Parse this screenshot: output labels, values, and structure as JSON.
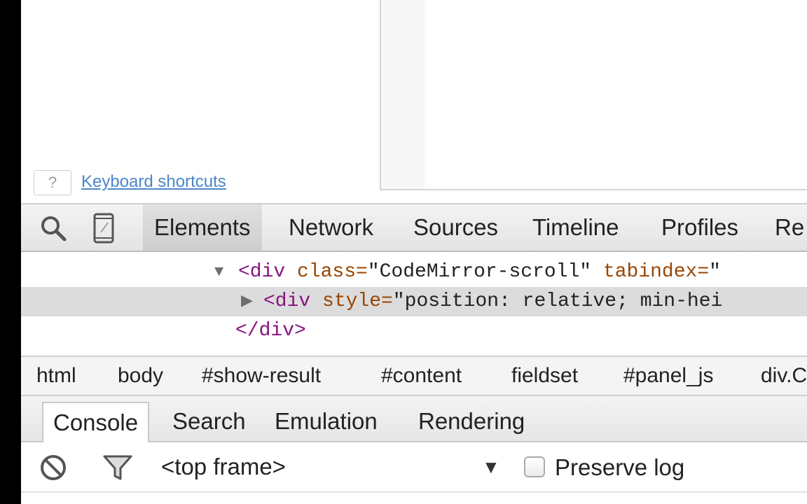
{
  "page": {
    "help_key": "?",
    "keyboard_link": "Keyboard shortcuts"
  },
  "devtools": {
    "tabs": [
      {
        "label": "Elements",
        "active": true
      },
      {
        "label": "Network"
      },
      {
        "label": "Sources"
      },
      {
        "label": "Timeline"
      },
      {
        "label": "Profiles"
      },
      {
        "label": "Re"
      }
    ],
    "icons": {
      "search": "search-icon",
      "device": "device-mode-icon"
    },
    "tree": {
      "row1": {
        "open": "<div",
        "attr1": " class=",
        "val1": "\"CodeMirror-scroll\"",
        "attr2": " tabindex=",
        "val2": "\""
      },
      "row2": {
        "open": "<div",
        "attr1": " style=",
        "val1": "\"position: relative; min-hei"
      },
      "row3": {
        "close": "</div>"
      }
    },
    "breadcrumbs": [
      "html",
      "body",
      "#show-result",
      "#content",
      "fieldset",
      "#panel_js",
      "div.C"
    ],
    "drawer_tabs": [
      {
        "label": "Console",
        "active": true
      },
      {
        "label": "Search"
      },
      {
        "label": "Emulation"
      },
      {
        "label": "Rendering"
      }
    ],
    "console": {
      "frame": "<top frame>",
      "preserve_log": "Preserve log",
      "icons": {
        "clear": "clear-console-icon",
        "filter": "filter-icon",
        "dropdown": "dropdown-arrow-icon"
      }
    }
  }
}
